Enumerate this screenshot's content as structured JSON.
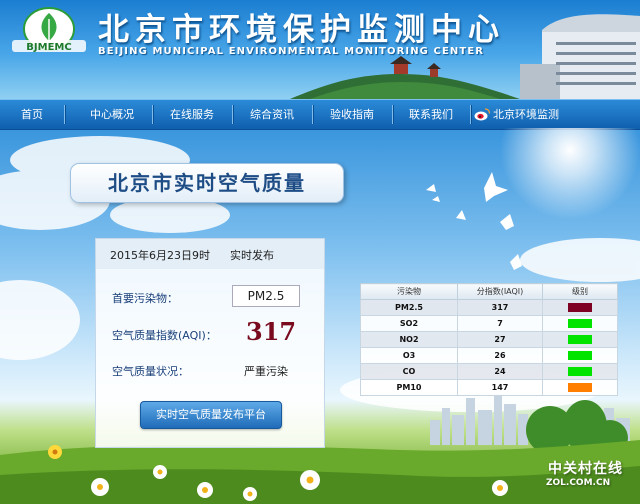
{
  "header": {
    "logo_text": "BJMEMC",
    "title": "北京市环境保护监测中心",
    "subtitle": "BEIJING MUNICIPAL ENVIRONMENTAL MONITORING CENTER"
  },
  "nav": {
    "items": [
      {
        "label": "首页"
      },
      {
        "label": "中心概况"
      },
      {
        "label": "在线服务"
      },
      {
        "label": "综合资讯"
      },
      {
        "label": "验收指南"
      },
      {
        "label": "联系我们"
      }
    ],
    "weibo_label": "北京环境监测"
  },
  "banner": {
    "title": "北京市实时空气质量"
  },
  "info": {
    "datetime": "2015年6月23日9时",
    "publish": "实时发布",
    "primary_label": "首要污染物：",
    "primary_value": "PM2.5",
    "aqi_label": "空气质量指数(AQI)：",
    "aqi_value": "317",
    "status_label": "空气质量状况：",
    "status_value": "严重污染",
    "platform_button": "实时空气质量发布平台"
  },
  "table": {
    "headers": [
      "污染物",
      "分指数(IAQI)",
      "级别"
    ],
    "rows": [
      {
        "pollutant": "PM2.5",
        "iaqi": "317",
        "color": "#7e0023"
      },
      {
        "pollutant": "SO2",
        "iaqi": "7",
        "color": "#00e400"
      },
      {
        "pollutant": "NO2",
        "iaqi": "27",
        "color": "#00e400"
      },
      {
        "pollutant": "O3",
        "iaqi": "26",
        "color": "#00e400"
      },
      {
        "pollutant": "CO",
        "iaqi": "24",
        "color": "#00e400"
      },
      {
        "pollutant": "PM10",
        "iaqi": "147",
        "color": "#ff7e00"
      }
    ]
  },
  "watermark": {
    "brand": "中关村在线",
    "url": "ZOL.COM.CN"
  }
}
